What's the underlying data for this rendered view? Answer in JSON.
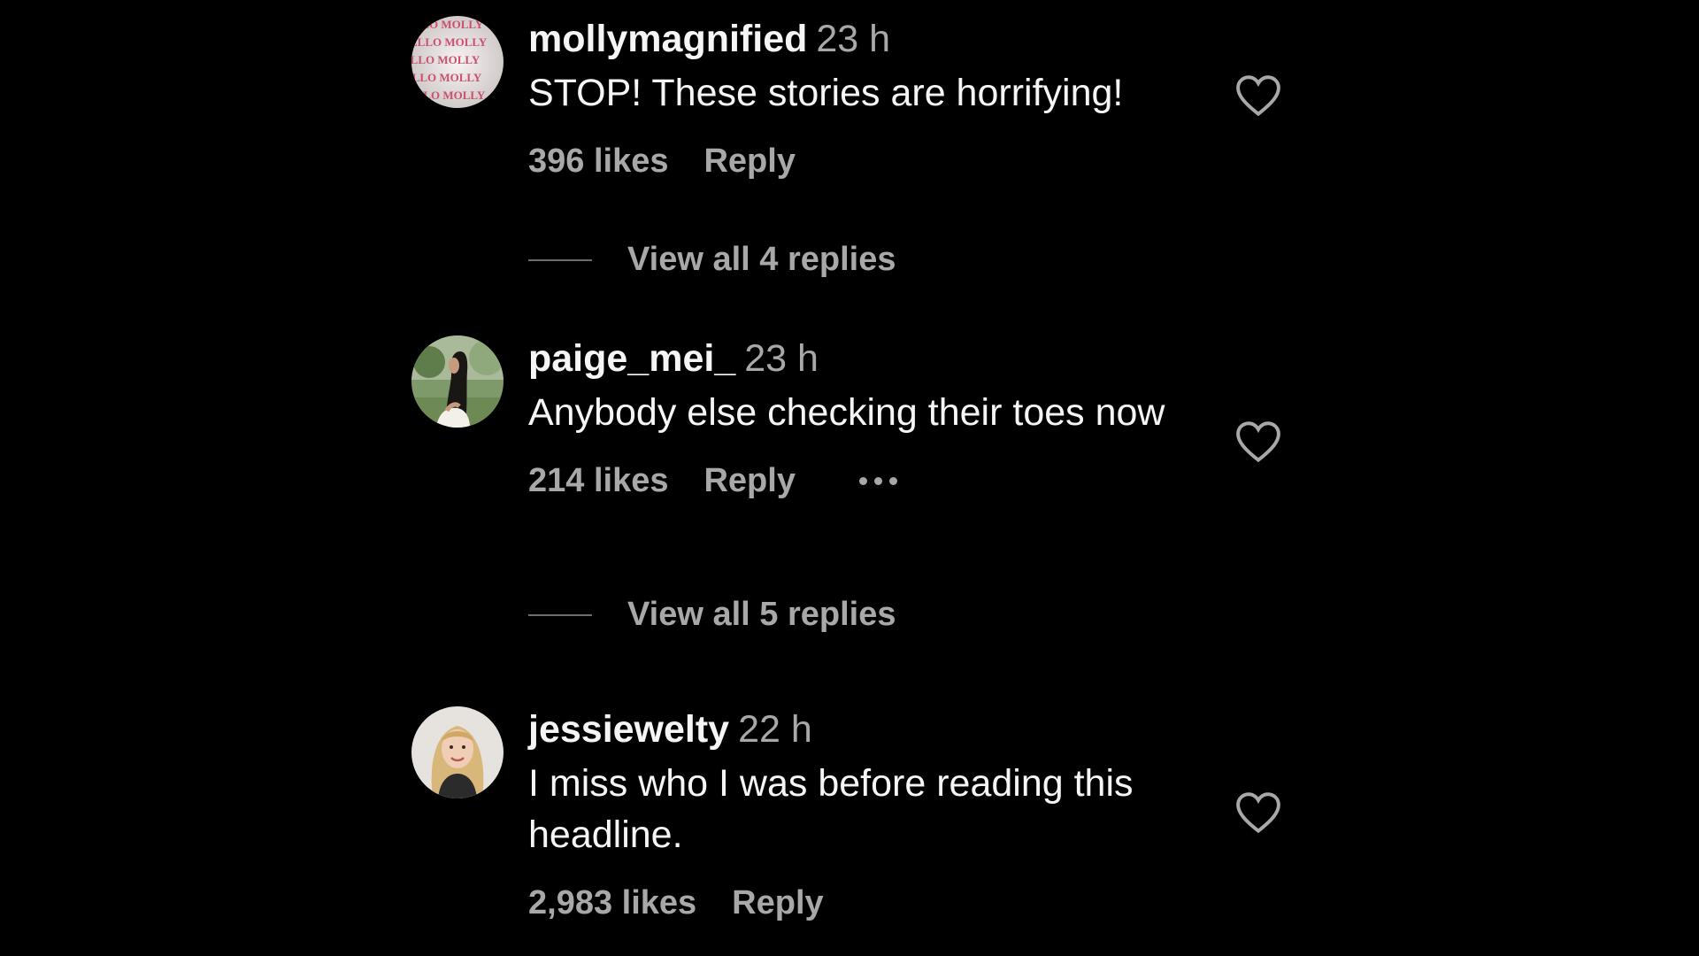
{
  "comments": [
    {
      "username": "mollymagnified",
      "time": "23 h",
      "text": "STOP! These stories are horrifying!",
      "likes": "396 likes",
      "reply": "Reply",
      "view_replies": "View all 4 replies",
      "avatar_text": "ELLO MOLLY"
    },
    {
      "username": "paige_mei_",
      "time": "23 h",
      "text": "Anybody else checking their toes now",
      "likes": "214 likes",
      "reply": "Reply",
      "view_replies": "View all 5 replies"
    },
    {
      "username": "jessiewelty",
      "time": "22 h",
      "text": "I miss who I was before reading this headline.",
      "likes": "2,983 likes",
      "reply": "Reply"
    }
  ],
  "icons": {
    "like": "heart-outline-icon",
    "more": "more-options-icon"
  },
  "colors": {
    "background": "#000000",
    "primary_text": "#f5f5f5",
    "secondary_text": "#a8a8a8"
  }
}
